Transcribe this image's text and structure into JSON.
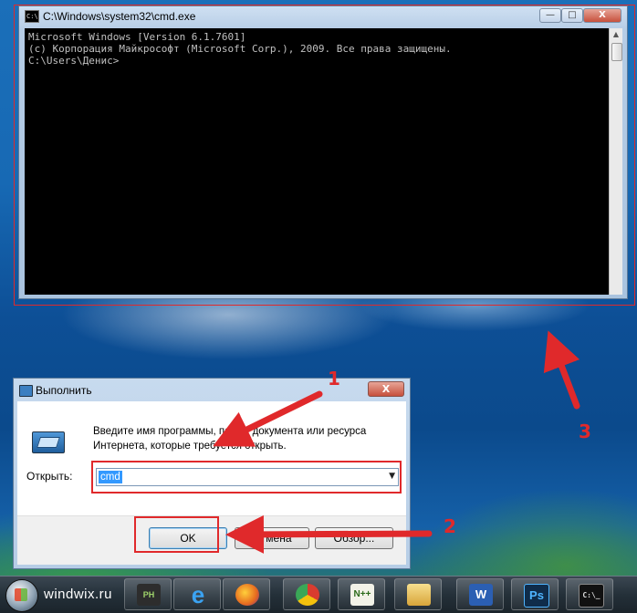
{
  "cmd_window": {
    "title": "C:\\Windows\\system32\\cmd.exe",
    "icon_text": "C:\\",
    "console_lines": [
      "Microsoft Windows [Version 6.1.7601]",
      "(c) Корпорация Майкрософт (Microsoft Corp.), 2009. Все права защищены.",
      "",
      "C:\\Users\\Денис>"
    ],
    "minimize_glyph": "—",
    "maximize_glyph": "□",
    "close_glyph": "X"
  },
  "run_dialog": {
    "title": "Выполнить",
    "close_glyph": "X",
    "description": "Введите имя программы, папки, документа или ресурса Интернета, которые требуется открыть.",
    "open_label": "Открыть:",
    "open_value": "cmd",
    "ok_label": "OK",
    "cancel_label": "Отмена",
    "browse_label": "Обзор..."
  },
  "annotations": {
    "step1": "1",
    "step2": "2",
    "step3": "3",
    "highlight_color": "#e0292b"
  },
  "taskbar": {
    "watermark": "windwix.ru",
    "apps": [
      {
        "name": "notepad-plus-plus",
        "icon_text": "N++",
        "color": "#6cae3a"
      },
      {
        "name": "internet-explorer",
        "icon_text": "e",
        "color": "#1e88d8"
      },
      {
        "name": "firefox",
        "icon_text": "ff",
        "color": "#e66a1f"
      },
      {
        "name": "chrome",
        "icon_text": "",
        "color": "#d93c2f"
      },
      {
        "name": "notepad-pp-2",
        "icon_text": "N",
        "color": "#8bb34a"
      },
      {
        "name": "file-explorer",
        "icon_text": "",
        "color": "#e9c25a"
      },
      {
        "name": "word",
        "icon_text": "W",
        "color": "#2b5fb3"
      },
      {
        "name": "photoshop",
        "icon_text": "Ps",
        "color": "#0f2c4a"
      },
      {
        "name": "cmd",
        "icon_text": "C:\\_",
        "color": "#111111"
      }
    ],
    "ps_icon_text": "PH"
  }
}
